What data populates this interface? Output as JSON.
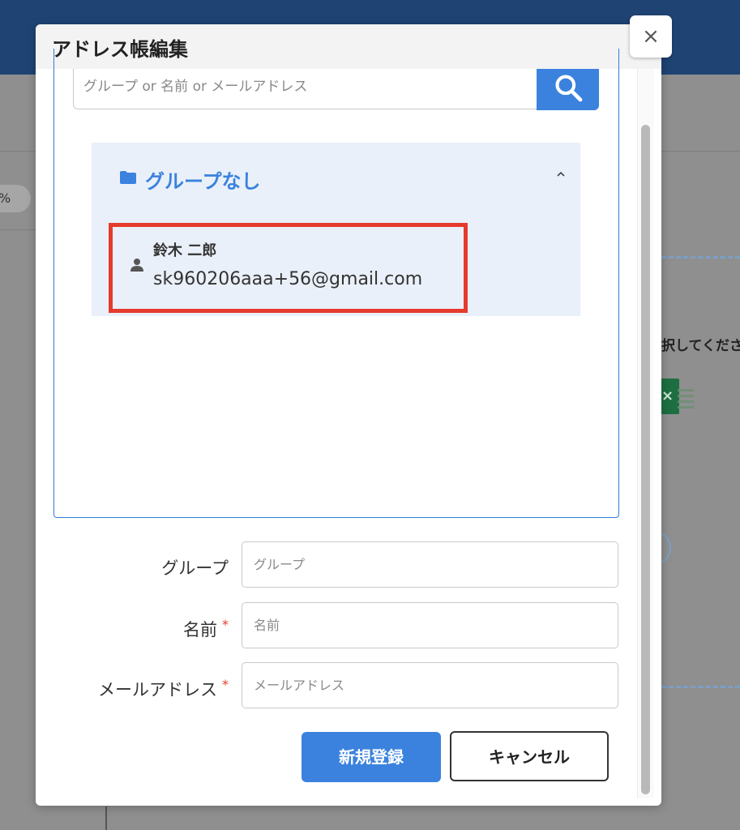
{
  "background": {
    "pill_text": "%",
    "select_prompt": "択してくださ"
  },
  "modal": {
    "title": "アドレス帳編集",
    "close_label": "×"
  },
  "search": {
    "placeholder": "グループ or 名前 or メールアドレス"
  },
  "group": {
    "title": "グループなし",
    "contacts": [
      {
        "name": "鈴木 二郎",
        "email": "sk960206aaa+56@gmail.com"
      }
    ]
  },
  "form": {
    "group_label": "グループ",
    "group_placeholder": "グループ",
    "name_label": "名前",
    "name_placeholder": "名前",
    "email_label": "メールアドレス",
    "email_placeholder": "メールアドレス",
    "required_mark": "*"
  },
  "buttons": {
    "register": "新規登録",
    "cancel": "キャンセル"
  },
  "colors": {
    "accent": "#3b82de",
    "highlight": "#e53b2c",
    "header_bg": "#1f4474"
  }
}
